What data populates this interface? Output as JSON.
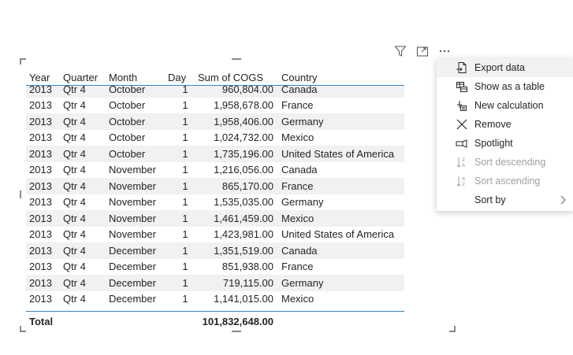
{
  "table": {
    "headers": {
      "year": "Year",
      "quarter": "Quarter",
      "month": "Month",
      "day": "Day",
      "cogs": "Sum of COGS",
      "country": "Country"
    },
    "rows": [
      {
        "year": "2013",
        "quarter": "Qtr 4",
        "month": "October",
        "day": "1",
        "cogs": "960,804.00",
        "country": "Canada"
      },
      {
        "year": "2013",
        "quarter": "Qtr 4",
        "month": "October",
        "day": "1",
        "cogs": "1,958,678.00",
        "country": "France"
      },
      {
        "year": "2013",
        "quarter": "Qtr 4",
        "month": "October",
        "day": "1",
        "cogs": "1,958,406.00",
        "country": "Germany"
      },
      {
        "year": "2013",
        "quarter": "Qtr 4",
        "month": "October",
        "day": "1",
        "cogs": "1,024,732.00",
        "country": "Mexico"
      },
      {
        "year": "2013",
        "quarter": "Qtr 4",
        "month": "October",
        "day": "1",
        "cogs": "1,735,196.00",
        "country": "United States of America"
      },
      {
        "year": "2013",
        "quarter": "Qtr 4",
        "month": "November",
        "day": "1",
        "cogs": "1,216,056.00",
        "country": "Canada"
      },
      {
        "year": "2013",
        "quarter": "Qtr 4",
        "month": "November",
        "day": "1",
        "cogs": "865,170.00",
        "country": "France"
      },
      {
        "year": "2013",
        "quarter": "Qtr 4",
        "month": "November",
        "day": "1",
        "cogs": "1,535,035.00",
        "country": "Germany"
      },
      {
        "year": "2013",
        "quarter": "Qtr 4",
        "month": "November",
        "day": "1",
        "cogs": "1,461,459.00",
        "country": "Mexico"
      },
      {
        "year": "2013",
        "quarter": "Qtr 4",
        "month": "November",
        "day": "1",
        "cogs": "1,423,981.00",
        "country": "United States of America"
      },
      {
        "year": "2013",
        "quarter": "Qtr 4",
        "month": "December",
        "day": "1",
        "cogs": "1,351,519.00",
        "country": "Canada"
      },
      {
        "year": "2013",
        "quarter": "Qtr 4",
        "month": "December",
        "day": "1",
        "cogs": "851,938.00",
        "country": "France"
      },
      {
        "year": "2013",
        "quarter": "Qtr 4",
        "month": "December",
        "day": "1",
        "cogs": "719,115.00",
        "country": "Germany"
      },
      {
        "year": "2013",
        "quarter": "Qtr 4",
        "month": "December",
        "day": "1",
        "cogs": "1,141,015.00",
        "country": "Mexico"
      }
    ],
    "total_label": "Total",
    "total_value": "101,832,648.00"
  },
  "header_icons": [
    "filter-icon",
    "focus-mode-icon",
    "more-options-icon"
  ],
  "menu": {
    "items": [
      {
        "label": "Export data",
        "icon": "export-icon",
        "disabled": false,
        "active": true
      },
      {
        "label": "Show as a table",
        "icon": "table-icon",
        "disabled": false
      },
      {
        "label": "New calculation",
        "icon": "calculation-icon",
        "disabled": false
      },
      {
        "label": "Remove",
        "icon": "close-icon",
        "disabled": false
      },
      {
        "label": "Spotlight",
        "icon": "spotlight-icon",
        "disabled": false
      },
      {
        "label": "Sort descending",
        "icon": "sort-descending-icon",
        "disabled": true
      },
      {
        "label": "Sort ascending",
        "icon": "sort-ascending-icon",
        "disabled": true
      },
      {
        "label": "Sort by",
        "icon": "chevron-right-icon",
        "disabled": false
      }
    ]
  },
  "colors": {
    "accent": "#2b88d8",
    "row_stripe": "#f1f1f1",
    "text": "#252423",
    "disabled_text": "#a19f9d"
  }
}
